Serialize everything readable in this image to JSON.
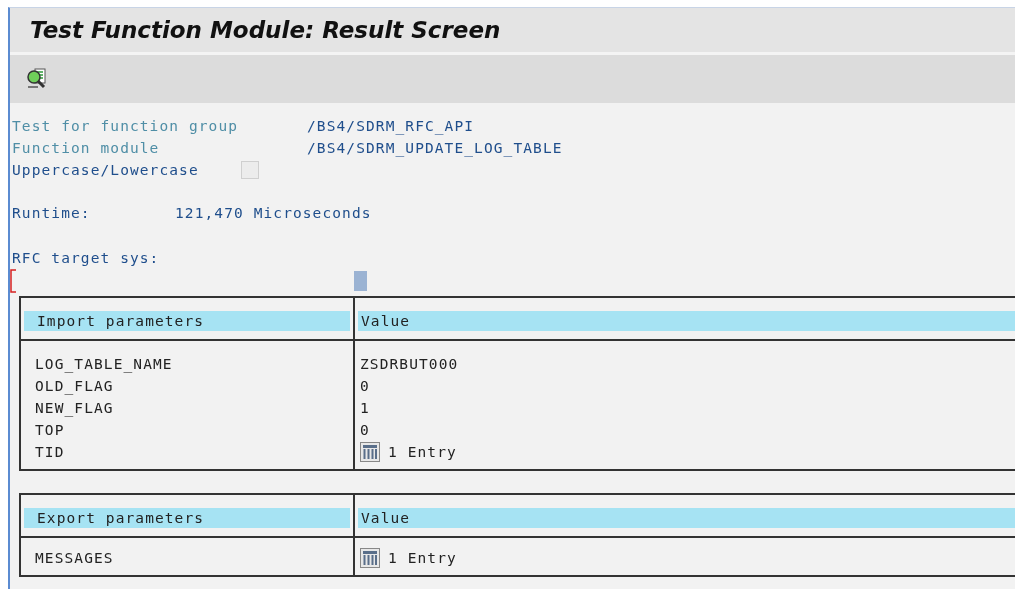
{
  "window": {
    "title": "Test Function Module: Result Screen"
  },
  "toolbar": {
    "buttons": [
      {
        "kind": "inspect"
      }
    ]
  },
  "info": [
    {
      "label": "Test for function group",
      "value": "/BS4/SDRM_RFC_API",
      "kind": "field"
    },
    {
      "label": "Function module",
      "value": "/BS4/SDRM_UPDATE_LOG_TABLE",
      "kind": "field"
    },
    {
      "label": "Uppercase/Lowercase",
      "checked": false,
      "kind": "checkbox"
    }
  ],
  "runtime": {
    "label": "Runtime:",
    "value": "121,470 Microseconds"
  },
  "rfc_target": {
    "label": "RFC target sys:"
  },
  "tables": [
    {
      "columns": [
        "Import parameters",
        "Value"
      ],
      "rows": [
        {
          "name": "LOG_TABLE_NAME",
          "value": "ZSDRBUT000",
          "kind": "text"
        },
        {
          "name": "OLD_FLAG",
          "value": "0",
          "kind": "text"
        },
        {
          "name": "NEW_FLAG",
          "value": "1",
          "kind": "text"
        },
        {
          "name": "TOP",
          "value": "0",
          "kind": "text"
        },
        {
          "name": "TID",
          "value": "1 Entry",
          "kind": "table"
        }
      ]
    },
    {
      "columns": [
        "Export parameters",
        "Value"
      ],
      "rows": [
        {
          "name": "MESSAGES",
          "value": "1 Entry",
          "kind": "table"
        }
      ]
    }
  ]
}
